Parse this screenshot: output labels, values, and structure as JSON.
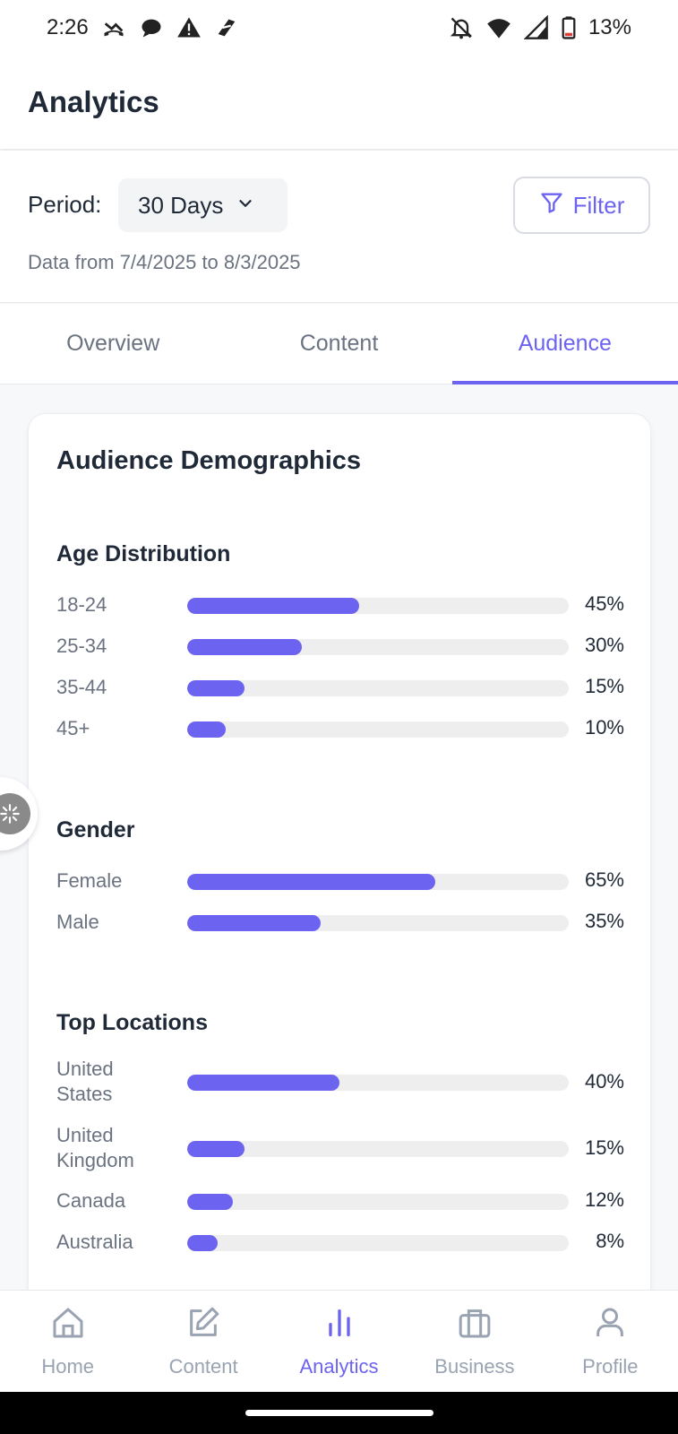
{
  "status_bar": {
    "time": "2:26",
    "battery": "13%",
    "left_icons": [
      "missed-call-icon",
      "chat-icon",
      "warning-icon",
      "app-icon"
    ],
    "right_icons": [
      "notifications-off-icon",
      "wifi-icon",
      "signal-icon",
      "battery-icon"
    ]
  },
  "header": {
    "title": "Analytics"
  },
  "period": {
    "label": "Period:",
    "selected": "30 Days",
    "filter_label": "Filter",
    "date_range": "Data from 7/4/2025 to 8/3/2025"
  },
  "tabs": [
    {
      "label": "Overview",
      "active": false
    },
    {
      "label": "Content",
      "active": false
    },
    {
      "label": "Audience",
      "active": true
    }
  ],
  "card": {
    "title": "Audience Demographics",
    "sections": [
      {
        "title": "Age Distribution",
        "rows": [
          {
            "label": "18-24",
            "value": "45%",
            "percent": 45
          },
          {
            "label": "25-34",
            "value": "30%",
            "percent": 30
          },
          {
            "label": "35-44",
            "value": "15%",
            "percent": 15
          },
          {
            "label": "45+",
            "value": "10%",
            "percent": 10
          }
        ]
      },
      {
        "title": "Gender",
        "rows": [
          {
            "label": "Female",
            "value": "65%",
            "percent": 65
          },
          {
            "label": "Male",
            "value": "35%",
            "percent": 35
          }
        ]
      },
      {
        "title": "Top Locations",
        "rows": [
          {
            "label": "United States",
            "value": "40%",
            "percent": 40
          },
          {
            "label": "United Kingdom",
            "value": "15%",
            "percent": 15
          },
          {
            "label": "Canada",
            "value": "12%",
            "percent": 12
          },
          {
            "label": "Australia",
            "value": "8%",
            "percent": 8
          }
        ]
      }
    ]
  },
  "bottom_nav": [
    {
      "label": "Home",
      "icon": "home-icon",
      "active": false
    },
    {
      "label": "Content",
      "icon": "edit-icon",
      "active": false
    },
    {
      "label": "Analytics",
      "icon": "bar-chart-icon",
      "active": true
    },
    {
      "label": "Business",
      "icon": "briefcase-icon",
      "active": false
    },
    {
      "label": "Profile",
      "icon": "user-icon",
      "active": false
    }
  ],
  "colors": {
    "accent": "#6c63f0",
    "track": "#eeeeee",
    "muted": "#6b7280"
  }
}
